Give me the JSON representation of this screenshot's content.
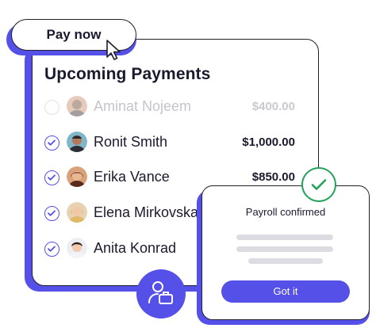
{
  "pay_button": {
    "label": "Pay now"
  },
  "card": {
    "title": "Upcoming Payments",
    "payments": [
      {
        "name": "Aminat Nojeem",
        "amount": "$400.00",
        "checked": false,
        "avatar": "person-avatar-1"
      },
      {
        "name": "Ronit Smith",
        "amount": "$1,000.00",
        "checked": true,
        "avatar": "person-avatar-2"
      },
      {
        "name": "Erika Vance",
        "amount": "$850.00",
        "checked": true,
        "avatar": "person-avatar-3"
      },
      {
        "name": "Elena Mirkovska",
        "amount": "",
        "checked": true,
        "avatar": "person-avatar-4"
      },
      {
        "name": "Anita Konrad",
        "amount": "",
        "checked": true,
        "avatar": "person-avatar-5"
      }
    ]
  },
  "popup": {
    "title": "Payroll confirmed",
    "button_label": "Got it"
  },
  "icons": {
    "cursor": "pointer-cursor-icon",
    "check": "checkmark-icon",
    "success": "success-check-icon",
    "payroll": "user-payroll-icon"
  },
  "colors": {
    "accent": "#5450e8",
    "success": "#22a25a",
    "text": "#1a1a2e",
    "muted": "#c4c4cc"
  }
}
